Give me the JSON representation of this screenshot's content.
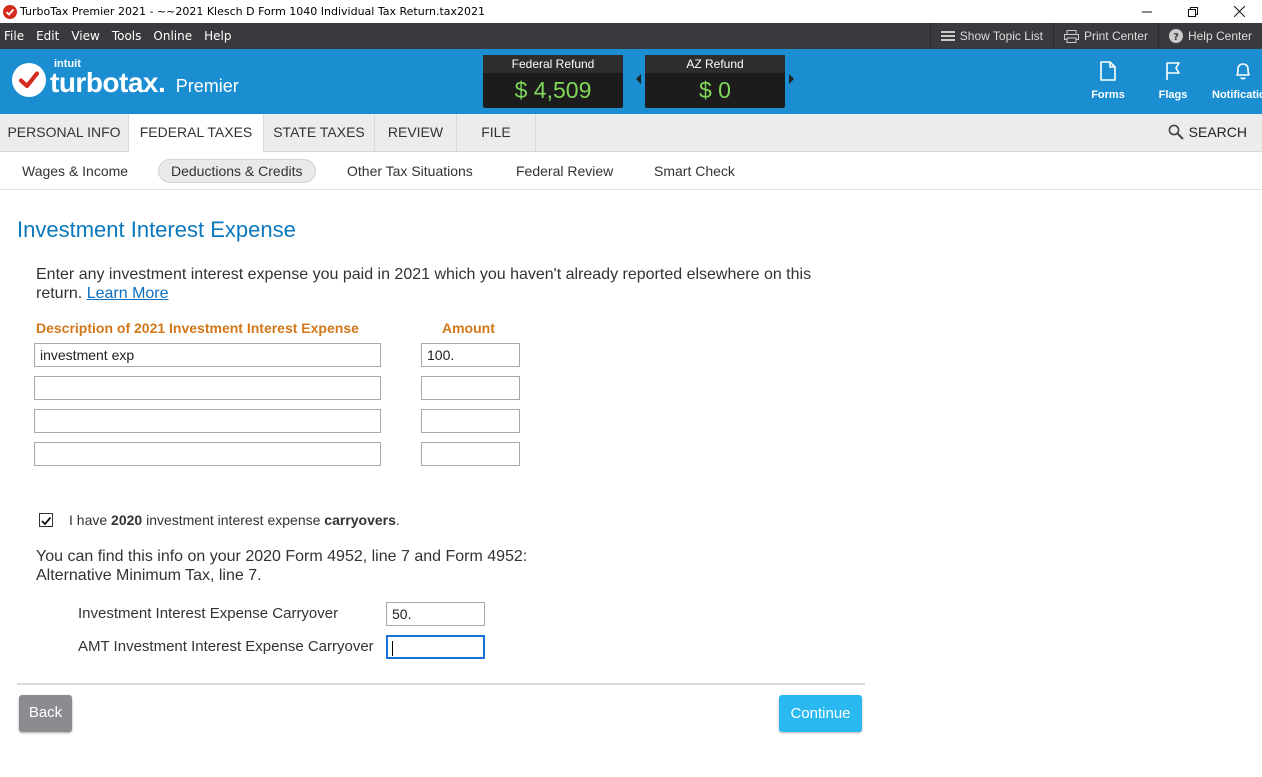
{
  "window": {
    "title": "TurboTax Premier 2021 - ~~2021 Klesch D Form 1040  Individual Tax Return.tax2021",
    "minimize_icon": "minimize-icon",
    "restore_icon": "restore-icon",
    "close_icon": "close-icon"
  },
  "menu": {
    "items": [
      "File",
      "Edit",
      "View",
      "Tools",
      "Online",
      "Help"
    ],
    "show_topic_list": "Show Topic List",
    "print_center": "Print Center",
    "help_center": "Help Center"
  },
  "brand": {
    "intuit": "intuit",
    "turbotax": "turbotax.",
    "edition": "Premier",
    "federal_refund_label": "Federal Refund",
    "federal_refund_amount": "$ 4,509",
    "state_refund_label": "AZ Refund",
    "state_refund_amount": "$ 0",
    "tools": [
      "Forms",
      "Flags",
      "Notifications"
    ]
  },
  "tabs": {
    "items": [
      "PERSONAL INFO",
      "FEDERAL TAXES",
      "STATE TAXES",
      "REVIEW",
      "FILE"
    ],
    "active": "FEDERAL TAXES",
    "search": "SEARCH"
  },
  "subnav": {
    "items": [
      "Wages & Income",
      "Deductions & Credits",
      "Other Tax Situations",
      "Federal Review",
      "Smart Check"
    ],
    "active": "Deductions & Credits"
  },
  "main": {
    "title": "Investment Interest Expense",
    "intro": "Enter any investment interest expense you paid in 2021 which you haven't already reported elsewhere on this return.",
    "learn_more": "Learn More",
    "col_description": "Description of 2021 Investment Interest Expense",
    "col_amount": "Amount",
    "rows": [
      {
        "description": "investment exp",
        "amount": "100."
      },
      {
        "description": "",
        "amount": ""
      },
      {
        "description": "",
        "amount": ""
      },
      {
        "description": "",
        "amount": ""
      }
    ],
    "carryover_checked": true,
    "carryover_pre": "I have ",
    "carryover_year": "2020",
    "carryover_mid": " investment interest expense ",
    "carryover_bold": "carryovers",
    "carryover_post": ".",
    "info": "You can find this info on your 2020 Form 4952, line 7 and Form 4952: Alternative Minimum Tax, line 7.",
    "carryover_label": "Investment Interest Expense Carryover",
    "carryover_value": "50.",
    "amt_carryover_label": "AMT Investment Interest Expense Carryover",
    "amt_carryover_value": "",
    "back": "Back",
    "continue": "Continue"
  }
}
